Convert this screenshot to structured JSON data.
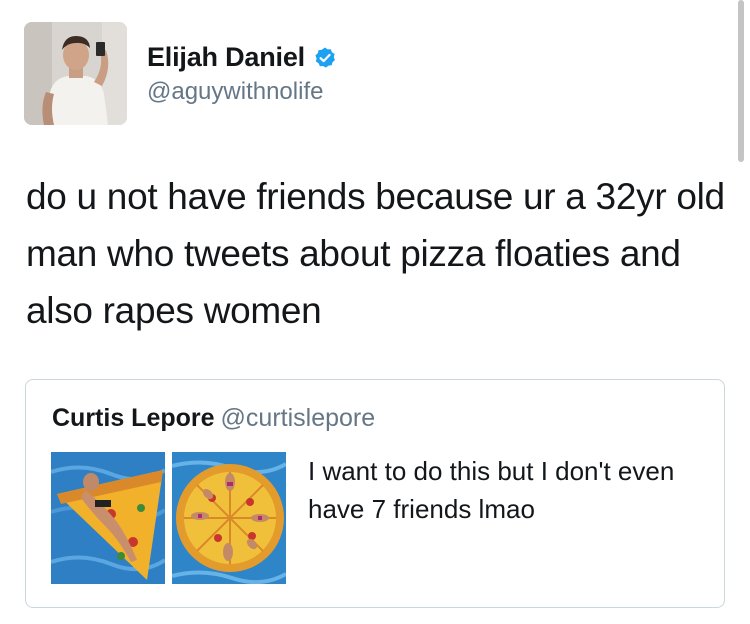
{
  "tweet": {
    "author": {
      "display_name": "Elijah Daniel",
      "handle": "@aguywithnolife",
      "verified": true,
      "avatar": "profile-photo"
    },
    "text": "do u not have friends because ur a 32yr old man who tweets about pizza floaties and also rapes women",
    "quoted_tweet": {
      "display_name": "Curtis Lepore",
      "handle": "@curtislepore",
      "text": "I want to do this but I don't even have 7 friends lmao",
      "media": [
        "pizza-float-photo",
        "pizza-float-group-photo"
      ]
    }
  },
  "colors": {
    "text": "#14171a",
    "secondary": "#657786",
    "verified_badge": "#1da1f2",
    "border": "#ccd6dd"
  }
}
